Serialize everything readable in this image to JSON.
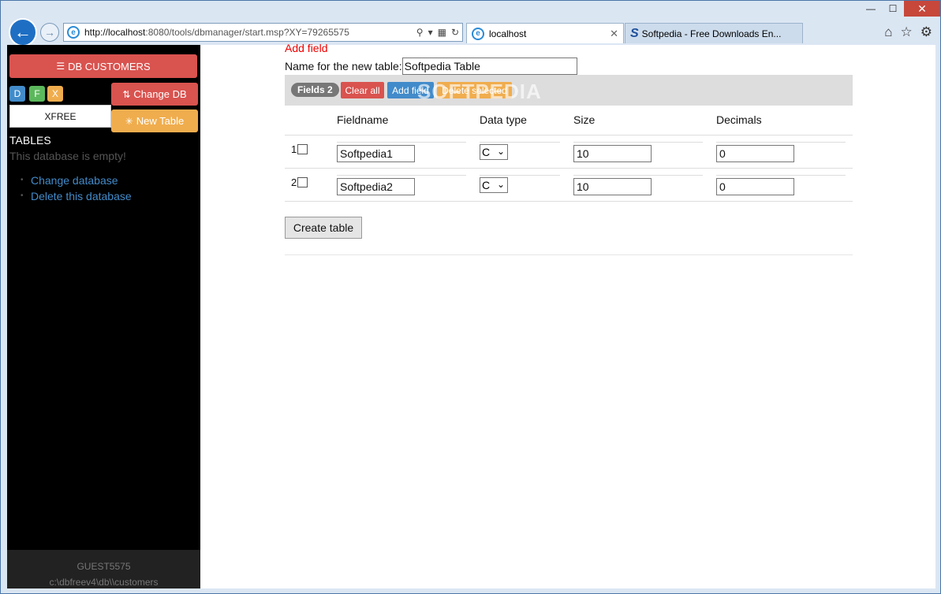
{
  "window": {
    "minimize": "—",
    "maximize": "☐",
    "close": "✕"
  },
  "browser": {
    "back_icon": "back-arrow-icon",
    "forward_icon": "forward-arrow-icon",
    "url_host": "http://localhost",
    "url_rest": ":8080/tools/dbmanager/start.msp?XY=79265575",
    "tabs": [
      {
        "label": "localhost",
        "active": true
      },
      {
        "label": "Softpedia - Free Downloads En...",
        "active": false
      }
    ]
  },
  "sidebar": {
    "db_button": "DB CUSTOMERS",
    "mini_buttons": [
      "D",
      "F",
      "X"
    ],
    "change_db": "Change DB",
    "new_table": "New Table",
    "db_name": "XFREE",
    "tables_label": "TABLES",
    "empty_message": "This database is empty!",
    "links": [
      "Change database",
      "Delete this database"
    ],
    "footer_user": "GUEST5575",
    "footer_path": "c:\\dbfreev4\\db\\\\customers"
  },
  "main": {
    "title": "Add field",
    "name_label": "Name for the new table:",
    "name_value": "Softpedia Table",
    "toolbar": {
      "fields_badge": "Fields 2",
      "clear_all": "Clear all",
      "add_field": "Add field",
      "delete_selected": "Delete selected",
      "watermark": "SOFTPEDIA"
    },
    "columns": [
      "Fieldname",
      "Data type",
      "Size",
      "Decimals"
    ],
    "rows": [
      {
        "num": "1",
        "fieldname": "Softpedia1",
        "datatype": "C",
        "size": "10",
        "decimals": "0"
      },
      {
        "num": "2",
        "fieldname": "Softpedia2",
        "datatype": "C",
        "size": "10",
        "decimals": "0"
      }
    ],
    "create_button": "Create table"
  },
  "colors": {
    "red": "#d9534f",
    "blue": "#428bca",
    "green": "#5cb85c",
    "orange": "#f0ad4e"
  }
}
